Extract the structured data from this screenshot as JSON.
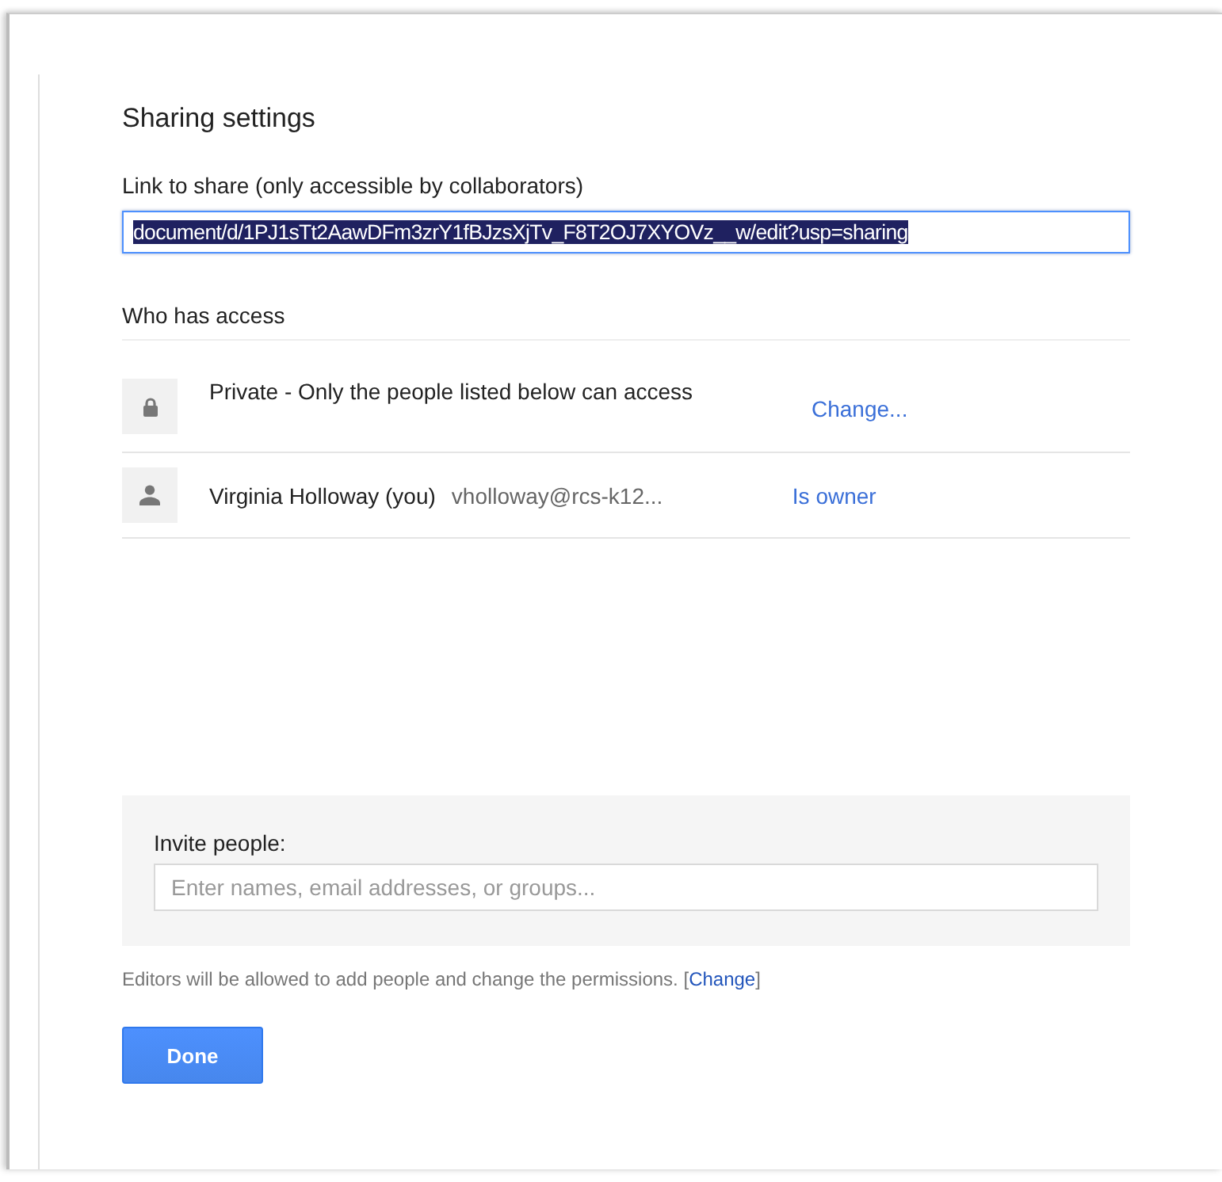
{
  "dialog": {
    "title": "Sharing settings",
    "link": {
      "label": "Link to share (only accessible by collaborators)",
      "value": "document/d/1PJ1sTt2AawDFm3zrY1fBJzsXjTv_F8T2OJ7XYOVz__w/edit?usp=sharing",
      "text_selected": true
    },
    "access": {
      "heading": "Who has access",
      "rows": [
        {
          "kind": "visibility",
          "text": "Private - Only the people listed below can access",
          "action": "Change..."
        },
        {
          "kind": "person",
          "name": "Virginia Holloway (you)",
          "email": "vholloway@rcs-k12...",
          "role": "Is owner"
        }
      ]
    },
    "invite": {
      "label": "Invite people:",
      "placeholder": "Enter names, email addresses, or groups..."
    },
    "note": {
      "text": "Editors will be allowed to add people and change the permissions.",
      "open_bracket": "[",
      "link": "Change",
      "close_bracket": "]"
    },
    "done_button": "Done"
  }
}
